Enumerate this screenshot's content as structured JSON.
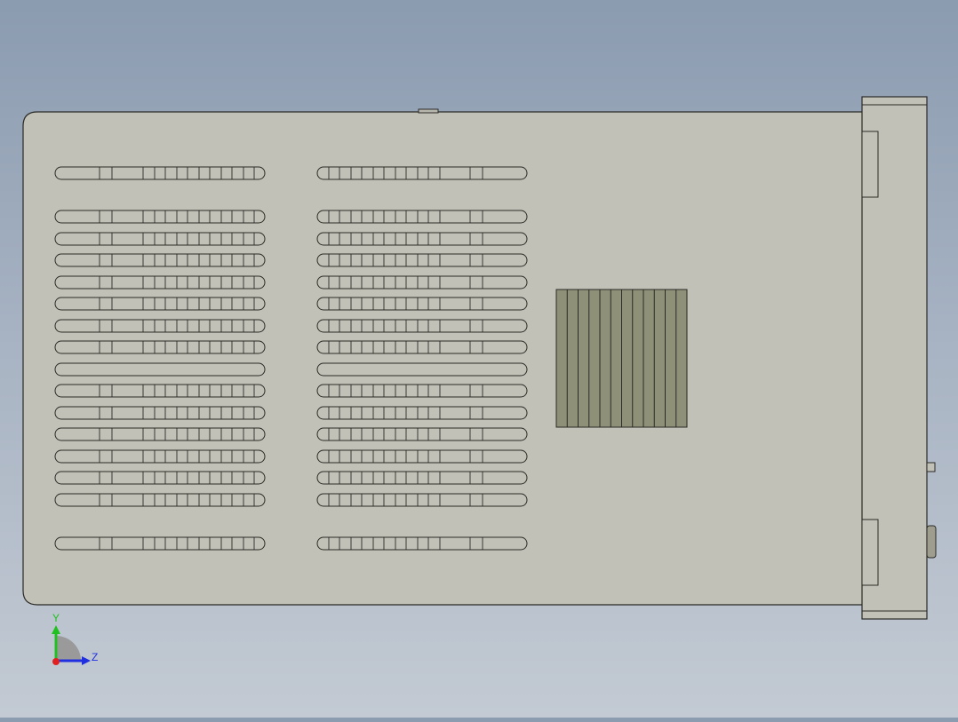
{
  "viewport": {
    "model_view": "Right",
    "colors": {
      "background_top": "#8b9bb0",
      "background_bottom": "#c3cad3",
      "body_fill": "#c2c1b7",
      "edge": "#2a2a26",
      "vent_fill": "#8f9078"
    }
  },
  "triad": {
    "y_label": "Y",
    "z_label": "Z",
    "colors": {
      "y": "#20c020",
      "z": "#2030e0",
      "x": "#e02020"
    }
  },
  "slots": {
    "left_column_rows": 17,
    "right_column_rows": 17,
    "blank_row_index": 8
  },
  "vent": {
    "fins": 12
  }
}
